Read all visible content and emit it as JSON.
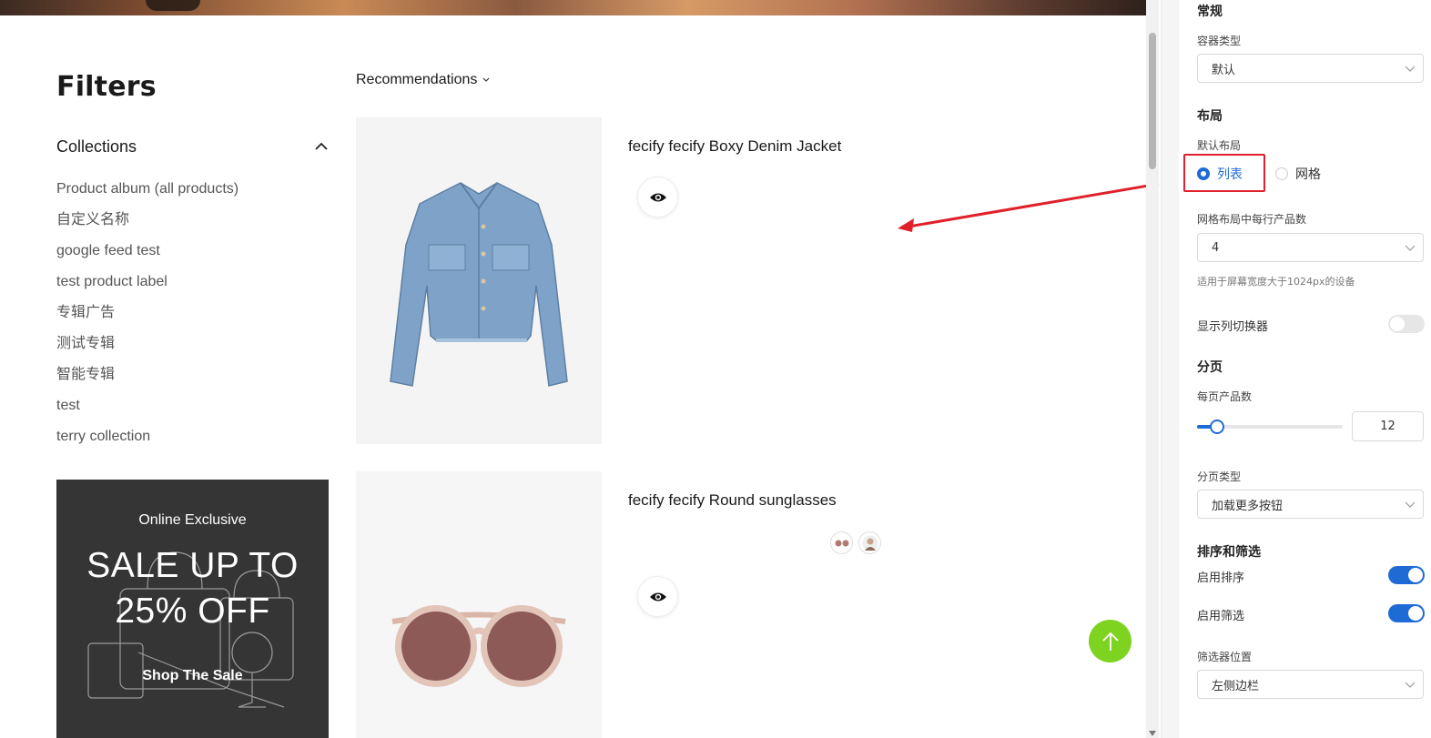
{
  "preview": {
    "filters_title": "Filters",
    "collections_label": "Collections",
    "collections": [
      "Product album (all products)",
      "自定义名称",
      "google feed test",
      "test product label",
      "专辑广告",
      "测试专辑",
      "智能专辑",
      "test",
      "terry collection"
    ],
    "promo": {
      "pre": "Online Exclusive",
      "line1": "SALE UP TO",
      "line2": "25% OFF",
      "cta": "Shop The Sale"
    },
    "sort_label": "Recommendations",
    "products": [
      {
        "title": "fecify fecify Boxy Denim Jacket"
      },
      {
        "title": "fecify fecify Round sunglasses"
      }
    ],
    "colors": {
      "back_to_top": "#7ed321",
      "annotation": "#e0202a"
    }
  },
  "panel": {
    "general": {
      "title": "常规",
      "container_label": "容器类型",
      "container_value": "默认"
    },
    "layout": {
      "title": "布局",
      "default_label": "默认布局",
      "option_list": "列表",
      "option_grid": "网格",
      "selected": "列表",
      "per_row_label": "网格布局中每行产品数",
      "per_row_value": "4",
      "per_row_hint": "适用于屏幕宽度大于1024px的设备",
      "show_switcher_label": "显示列切换器",
      "show_switcher": false
    },
    "pagination": {
      "title": "分页",
      "per_page_label": "每页产品数",
      "per_page_value": "12",
      "per_page_slider_fraction": 0.14,
      "type_label": "分页类型",
      "type_value": "加载更多按钮"
    },
    "sort_filter": {
      "title": "排序和筛选",
      "enable_sort_label": "启用排序",
      "enable_sort": true,
      "enable_filter_label": "启用筛选",
      "enable_filter": true,
      "position_label": "筛选器位置",
      "position_value": "左侧边栏"
    },
    "colors": {
      "accent": "#1e6bd6",
      "highlight_border": "#e0202a"
    }
  }
}
